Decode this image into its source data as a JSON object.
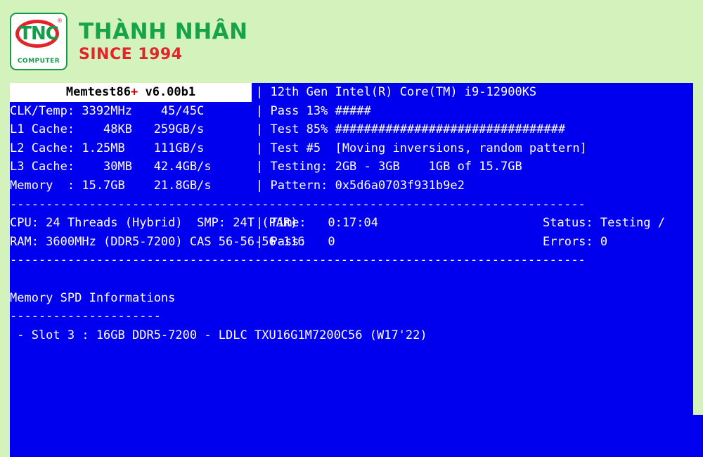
{
  "branding": {
    "logo": {
      "mark_text": "TNC",
      "registered_symbol": "®",
      "sub_text": "COMPUTER"
    },
    "company_name": "THÀNH NHÂN",
    "tagline": "SINCE 1994",
    "green": "#16a34a",
    "red": "#e4242b",
    "background": "#d4f2bc"
  },
  "memtest": {
    "background": "#0000ee",
    "foreground": "#ffffff",
    "title_prefix": "Memtest86",
    "title_plus": "+",
    "title_version": " v6.00b1",
    "cpu_model": "12th Gen Intel(R) Core(TM) i9-12900KS",
    "left_panel": {
      "rows": [
        {
          "label": "CLK/Temp:",
          "value": "3392MHz",
          "extra": "45/45C"
        },
        {
          "label": "L1 Cache:",
          "value": "48KB",
          "extra": "259GB/s"
        },
        {
          "label": "L2 Cache:",
          "value": "1.25MB",
          "extra": "111GB/s"
        },
        {
          "label": "L3 Cache:",
          "value": "30MB",
          "extra": "42.4GB/s"
        },
        {
          "label": "Memory  :",
          "value": "15.7GB",
          "extra": "21.8GB/s"
        }
      ],
      "lines": [
        "CLK/Temp: 3392MHz    45/45C ",
        "L1 Cache:    48KB   259GB/s ",
        "L2 Cache: 1.25MB    111GB/s ",
        "L3 Cache:    30MB   42.4GB/s",
        "Memory  : 15.7GB    21.8GB/s"
      ]
    },
    "right_panel": {
      "pass_label": "Pass",
      "pass_percent": "13%",
      "pass_bar": "#####",
      "test_label": "Test",
      "test_percent": "85%",
      "test_bar": "################################",
      "test_number": "Test #5",
      "test_name": "[Moving inversions, random pattern]",
      "testing_label": "Testing:",
      "testing_range": "2GB - 3GB",
      "testing_progress": "1GB of 15.7GB",
      "pattern_label": "Pattern:",
      "pattern_value": "0x5d6a0703f931b9e2",
      "lines": [
        "| 12th Gen Intel(R) Core(TM) i9-12900KS",
        "| Pass 13% #####",
        "| Test 85% ################################",
        "| Test #5  [Moving inversions, random pattern]",
        "| Testing: 2GB - 3GB    1GB of 15.7GB",
        "| Pattern: 0x5d6a0703f931b9e2"
      ]
    },
    "divider_top": "--------------------------------------------------------------------------------",
    "divider_bottom": "--------------------------------------------------------------------------------",
    "system": {
      "cpu_line": "CPU: 24 Threads (Hybrid)  SMP: 24T (PAR) ",
      "ram_line": "RAM: 3600MHz (DDR5-7200) CAS 56-56-56-116",
      "cpu_label": "CPU:",
      "cpu_threads": "24 Threads (Hybrid)",
      "smp_label": "SMP:",
      "smp_value": "24T (PAR)",
      "ram_label": "RAM:",
      "ram_speed": "3600MHz (DDR5-7200)",
      "ram_cas": "CAS 56-56-56-116",
      "time_line": "| Time:   0:17:04",
      "pass_line": "| Pass:   0",
      "time_label": "Time:",
      "time_value": "0:17:04",
      "pass_label": "Pass:",
      "pass_value": "0",
      "status_line": "Status: Testing /",
      "errors_line": "Errors: 0",
      "status_label": "Status:",
      "status_value": "Testing /",
      "errors_label": "Errors:",
      "errors_value": "0"
    },
    "spd": {
      "heading": "Memory SPD Informations",
      "underline": "---------------------",
      "slots": [
        " - Slot 3 : 16GB DDR5-7200 - LDLC TXU16G1M7200C56 (W17'22)"
      ]
    }
  }
}
